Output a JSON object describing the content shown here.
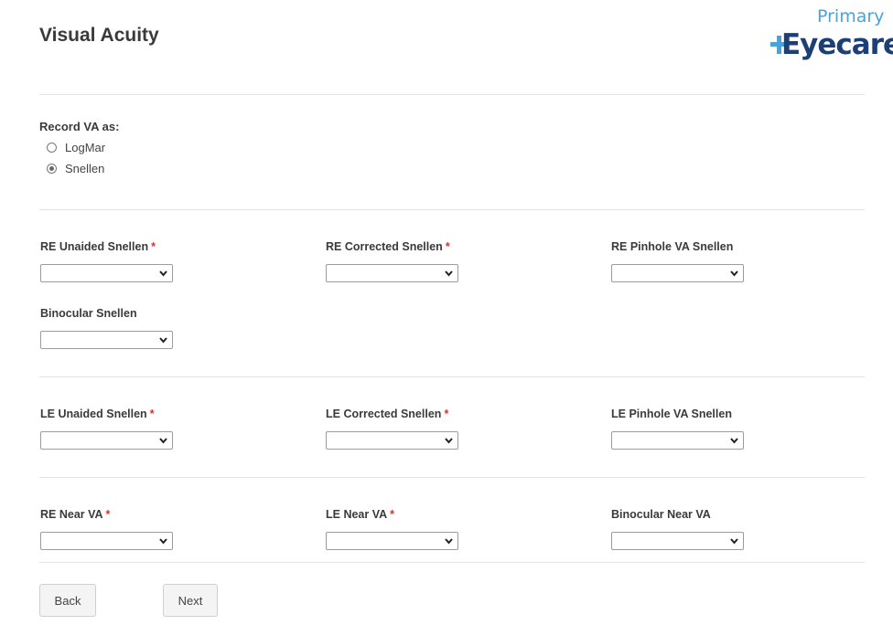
{
  "header": {
    "title": "Visual Acuity",
    "logo_top": "Primary",
    "logo_bottom": "Eyecare"
  },
  "record_va": {
    "label": "Record VA as:",
    "options": [
      {
        "label": "LogMar",
        "checked": false
      },
      {
        "label": "Snellen",
        "checked": true
      }
    ]
  },
  "fields": {
    "re_unaided": {
      "label": "RE Unaided Snellen",
      "required": "*",
      "value": ""
    },
    "re_corrected": {
      "label": "RE Corrected Snellen",
      "required": "*",
      "value": ""
    },
    "re_pinhole": {
      "label": "RE Pinhole VA Snellen",
      "value": ""
    },
    "binocular": {
      "label": "Binocular Snellen",
      "value": ""
    },
    "le_unaided": {
      "label": "LE Unaided Snellen",
      "required": "*",
      "value": ""
    },
    "le_corrected": {
      "label": "LE Corrected Snellen",
      "required": "*",
      "value": ""
    },
    "le_pinhole": {
      "label": "LE Pinhole VA Snellen",
      "value": ""
    },
    "re_near": {
      "label": "RE Near VA",
      "required": "*",
      "value": ""
    },
    "le_near": {
      "label": "LE Near VA",
      "required": "*",
      "value": ""
    },
    "binocular_near": {
      "label": "Binocular Near VA",
      "value": ""
    }
  },
  "buttons": {
    "back": "Back",
    "next": "Next"
  },
  "colors": {
    "accent_light": "#4aa3d8",
    "accent_dark": "#1c3f75",
    "required": "#d9342b"
  }
}
